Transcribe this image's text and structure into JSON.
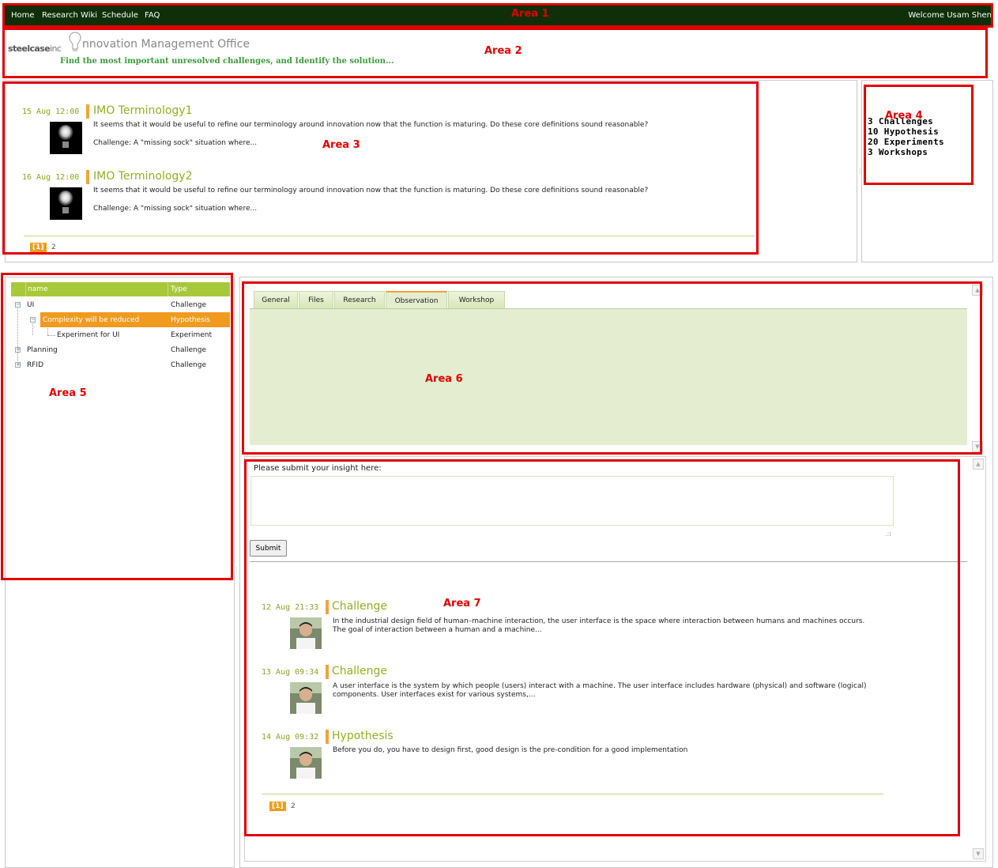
{
  "annotations": {
    "area1": "Area 1",
    "area2": "Area 2",
    "area3": "Area 3",
    "area4": "Area 4",
    "area5": "Area 5",
    "area6": "Area 6",
    "area7": "Area 7"
  },
  "nav": {
    "items": [
      "Home",
      "Research Wiki",
      "Schedule",
      "FAQ"
    ],
    "welcome": "Welcome Usam Shen"
  },
  "header": {
    "logo_bold": "steelcase",
    "logo_thin": "inc",
    "title": "nnovation Management Office",
    "tagline": "Find the most important unresolved challenges, and Identify the solution..."
  },
  "news": {
    "entries": [
      {
        "date": "15 Aug 12:00",
        "title": "IMO Terminology1",
        "text": "It seems that it would be useful to refine our terminology around innovation now that the function is maturing. Do these core definitions sound reasonable?",
        "challenge": "Challenge: A \"missing sock\" situation where..."
      },
      {
        "date": "16 Aug 12:00",
        "title": "IMO Terminology2",
        "text": "It seems that it would be useful to refine our terminology around innovation now that the function is maturing. Do these core definitions sound reasonable?",
        "challenge": "Challenge: A \"missing sock\" situation where..."
      }
    ],
    "pager": {
      "current": "[1]",
      "next": "2"
    }
  },
  "stats": {
    "lines": [
      "3  Challenges",
      "10 Hypothesis",
      "20 Experiments",
      "3 Workshops"
    ]
  },
  "tree": {
    "columns": {
      "name": "name",
      "type": "Type"
    },
    "rows": [
      {
        "name": "UI",
        "type": "Challenge"
      },
      {
        "name": "Complexity will be reduced",
        "type": "Hypothesis"
      },
      {
        "name": "Experiment for UI",
        "type": "Experiment"
      },
      {
        "name": "Planning",
        "type": "Challenge"
      },
      {
        "name": "RFID",
        "type": "Challenge"
      }
    ]
  },
  "tabs": {
    "labels": [
      "General",
      "Files",
      "Research",
      "Observation",
      "Workshop"
    ],
    "active": "Observation"
  },
  "insight": {
    "label": "Please submit your insight here:",
    "value": "",
    "submit": "Submit",
    "entries": [
      {
        "date": "12 Aug 21:33",
        "title": "Challenge",
        "text": "In the industrial design field of human–machine interaction, the user interface is the space where interaction between humans and machines occurs. The goal of interaction between a human and a machine..."
      },
      {
        "date": "13 Aug 09:34",
        "title": "Challenge",
        "text": "A user interface is the system by which people (users) interact with a machine. The user interface includes hardware (physical) and software (logical) components. User interfaces exist for various systems,..."
      },
      {
        "date": "14 Aug 09:32",
        "title": "Hypothesis",
        "text": "Before you do, you have to design first, good design is the pre-condition for a good implementation"
      }
    ],
    "pager": {
      "current": "[1]",
      "next": "2"
    }
  },
  "colors": {
    "nav_bg": "#0f2f08",
    "accent_green": "#8fb022",
    "accent_orange": "#f09a1e",
    "annotation_red": "#e00000",
    "panel_green": "#e4edcf"
  }
}
